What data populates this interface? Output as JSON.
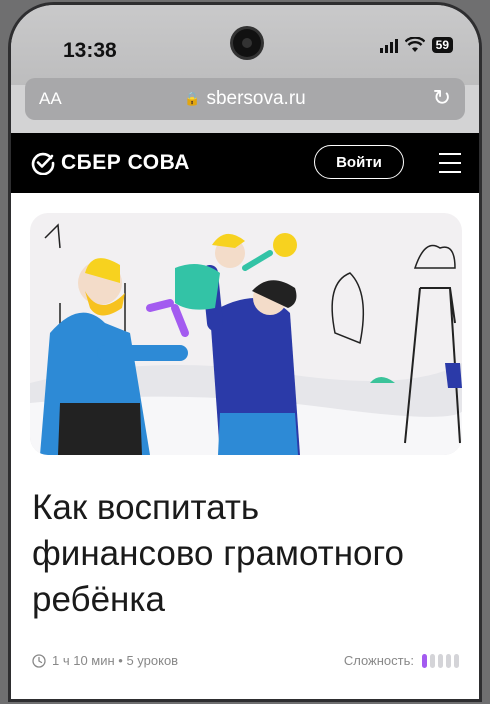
{
  "status": {
    "time": "13:38",
    "battery": "59"
  },
  "browser": {
    "text_size": "AA",
    "url": "sbersova.ru"
  },
  "header": {
    "logo": "СБЕР СОВА",
    "login": "Войти"
  },
  "article": {
    "title_lines": [
      "Как воспитать",
      "финансово грамотного",
      "ребёнка"
    ],
    "duration": "1 ч 10 мин • 5 уроков",
    "difficulty_label": "Сложность:",
    "difficulty_level": 1,
    "difficulty_max": 5
  },
  "colors": {
    "accent": "#a35bf0",
    "header_bg": "#000000"
  }
}
